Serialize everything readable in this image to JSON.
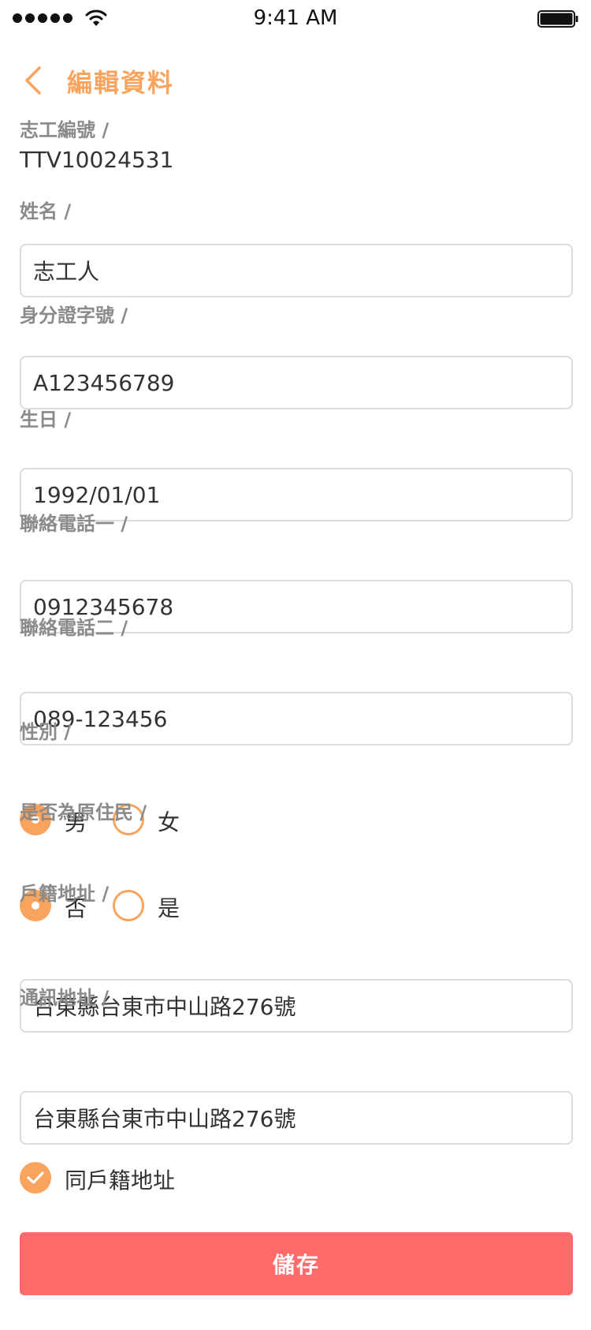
{
  "status_bar": {
    "time": "9:41 AM"
  },
  "header": {
    "title": "編輯資料"
  },
  "fields": {
    "volunteer_id": {
      "label": "志工編號 /",
      "value": "TTV10024531"
    },
    "name": {
      "label": "姓名 /",
      "value": "志工人"
    },
    "id_number": {
      "label": "身分證字號 /",
      "value": "A123456789"
    },
    "birthday": {
      "label": "生日 /",
      "value": "1992/01/01"
    },
    "phone1": {
      "label": "聯絡電話一 /",
      "value": "0912345678"
    },
    "phone2": {
      "label": "聯絡電話二 /",
      "value": "089-123456"
    },
    "gender": {
      "label": "性別 /",
      "options": [
        "男",
        "女"
      ],
      "selected": "男"
    },
    "aboriginal": {
      "label": "是否為原住民 /",
      "options": [
        "否",
        "是"
      ],
      "selected": "否"
    },
    "registered_address": {
      "label": "戶籍地址 /",
      "value": "台東縣台東市中山路276號"
    },
    "mailing_address": {
      "label": "通訊地址 /",
      "value": "台東縣台東市中山路276號"
    },
    "same_as_registered": {
      "label": "同戶籍地址",
      "checked": true
    }
  },
  "actions": {
    "save_label": "儲存"
  },
  "colors": {
    "accent": "#F9A45E",
    "save_button": "#FF6A6A",
    "label": "#8A8A8A",
    "border": "#DCDCDC"
  }
}
